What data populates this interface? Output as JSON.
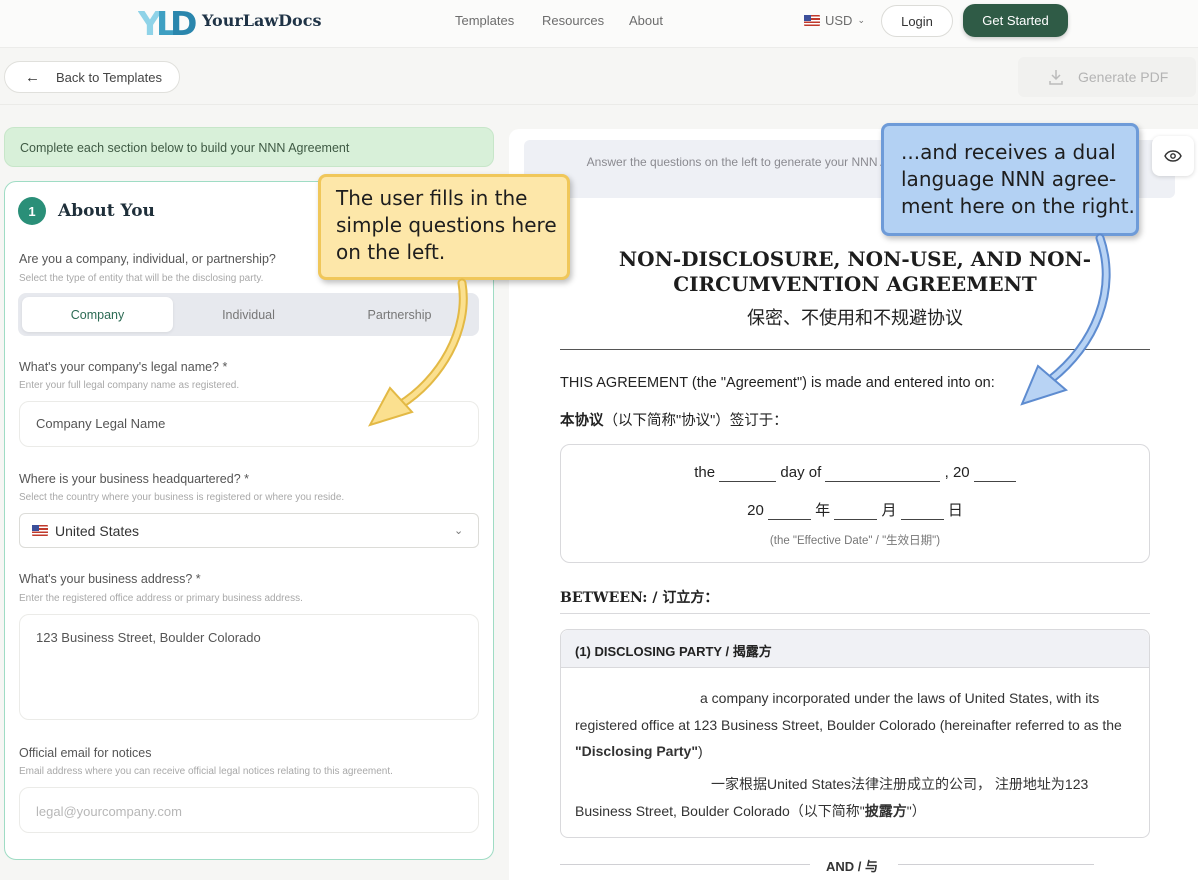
{
  "brand": {
    "name": "YourLawDocs",
    "logo_letters": "YLD"
  },
  "nav": {
    "templates": "Templates",
    "resources": "Resources",
    "about": "About",
    "currency": "USD",
    "login": "Login",
    "get_started": "Get Started"
  },
  "toolbar": {
    "back_label": "Back to Templates",
    "generate_pdf": "Generate PDF"
  },
  "form": {
    "banner": "Complete each section below to build your NNN Agreement",
    "section_number": "1",
    "section_title": "About You",
    "entity_question": "Are you a company, individual, or partnership?",
    "entity_help": "Select the type of entity that will be the disclosing party.",
    "entity_options": [
      "Company",
      "Individual",
      "Partnership"
    ],
    "entity_selected": "Company",
    "name_question": "What's your company's legal name? *",
    "name_help": "Enter your full legal company name as registered.",
    "name_value": "Company Legal Name",
    "hq_question": "Where is your business headquartered? *",
    "hq_help": "Select the country where your business is registered or where you reside.",
    "hq_value": "United States",
    "address_question": "What's your business address? *",
    "address_help": "Enter the registered office address or primary business address.",
    "address_value": "123 Business Street, Boulder Colorado",
    "email_question": "Official email for notices",
    "email_help": "Email address where you can receive official legal notices relating to this agreement.",
    "email_placeholder": "legal@yourcompany.com"
  },
  "document": {
    "hint": "Answer the questions on the left to generate your NNN Agreement. Your preview will appear below.",
    "title_en": "NON-DISCLOSURE, NON-USE, AND NON-CIRCUMVENTION AGREEMENT",
    "title_cn": "保密、不使用和不规避协议",
    "intro_en_bold": "THIS AGREEMENT",
    "intro_en_rest": " (the \"Agreement\") is made and entered into on:",
    "intro_cn_bold": "本协议",
    "intro_cn_rest": "（以下简称\"协议\"）签订于：",
    "date_the": "the",
    "date_day_of": "day of",
    "date_comma_20": ", 20",
    "date_cn_20": "20",
    "date_cn_year": "年",
    "date_cn_month": "月",
    "date_cn_day": "日",
    "date_note": "(the \"Effective Date\" / \"生效日期\")",
    "between": "BETWEEN: / 订立方：",
    "party_header": "(1) DISCLOSING PARTY / 揭露方",
    "party_en": "a company incorporated under the laws of United States, with its registered office at 123 Business Street, Boulder Colorado (hereinafter referred to as the ",
    "party_en_bold": "\"Disclosing Party\"",
    "party_en_end": ")",
    "party_cn": "一家根据United States法律注册成立的公司， 注册地址为123 Business Street, Boulder Colorado（以下简称\"",
    "party_cn_bold": "披露方",
    "party_cn_end": "\"）",
    "and": "AND / 与"
  },
  "callouts": {
    "left": "The user fills in the simple questions here on the left.",
    "right": "...and receives a dual language NNN agree-ment here on the right."
  },
  "colors": {
    "primary": "#2f5b46",
    "accent_teal": "#2a8f78",
    "banner_bg": "#d8f0d9",
    "callout_yellow": "#fde7a9",
    "callout_blue": "#b3d1f3"
  }
}
